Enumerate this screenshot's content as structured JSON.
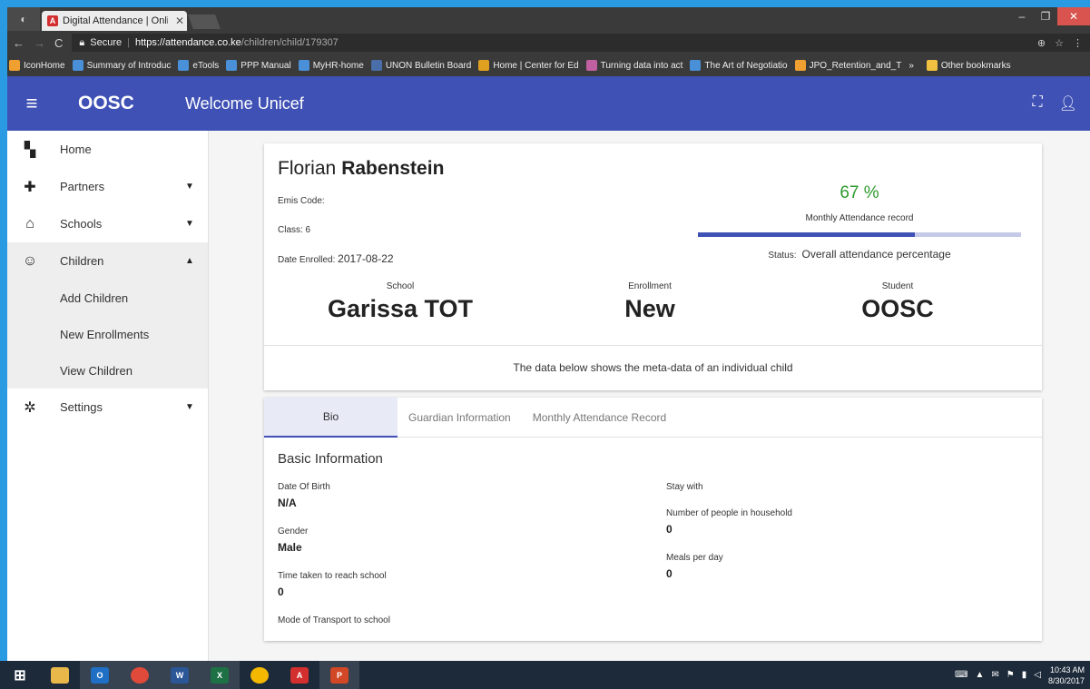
{
  "browser": {
    "tab_title": "Digital Attendance | Onli",
    "url_secure": "Secure",
    "url_host": "https://attendance.co.ke",
    "url_path": "/children/child/179307",
    "bookmarks": [
      {
        "label": "IconHome",
        "color": "#f0a030"
      },
      {
        "label": "Summary of Introduc",
        "color": "#4a90d9"
      },
      {
        "label": "eTools",
        "color": "#4a90d9"
      },
      {
        "label": "PPP Manual",
        "color": "#4a90d9"
      },
      {
        "label": "MyHR-home",
        "color": "#4a90d9"
      },
      {
        "label": "UNON Bulletin Board",
        "color": "#4a6ea9"
      },
      {
        "label": "Home | Center for Ed",
        "color": "#e0a020"
      },
      {
        "label": "Turning data into act",
        "color": "#c060a0"
      },
      {
        "label": "The Art of Negotiatio",
        "color": "#4a90d9"
      },
      {
        "label": "JPO_Retention_and_T",
        "color": "#f0a030"
      }
    ],
    "bookmarks_more": "»",
    "other_bookmarks": "Other bookmarks"
  },
  "app": {
    "brand": "OOSC",
    "welcome": "Welcome Unicef"
  },
  "sidebar": {
    "items": [
      {
        "label": "Home",
        "icon": "dashboard-icon",
        "glyph": "▚"
      },
      {
        "label": "Partners",
        "icon": "puzzle-icon",
        "glyph": "✚"
      },
      {
        "label": "Schools",
        "icon": "home-icon",
        "glyph": "⌂"
      },
      {
        "label": "Children",
        "icon": "face-icon",
        "glyph": "☺"
      },
      {
        "label": "Settings",
        "icon": "gear-icon",
        "glyph": "✲"
      }
    ],
    "children_sub": [
      "Add Children",
      "New Enrollments",
      "View Children"
    ]
  },
  "student": {
    "first_name": "Florian",
    "last_name": "Rabenstein",
    "emis_label": "Emis Code:",
    "class_label": "Class: 6",
    "enrolled_label": "Date Enrolled:",
    "enrolled_value": "2017-08-22",
    "attendance_pct_text": "67 %",
    "attendance_fraction": 0.67,
    "attendance_label": "Monthly Attendance record",
    "status_label": "Status:",
    "status_value": "Overall attendance percentage",
    "school_caption": "School",
    "school_value": "Garissa TOT",
    "enrollment_caption": "Enrollment",
    "enrollment_value": "New",
    "student_caption": "Student",
    "student_value": "OOSC",
    "note": "The data below shows the meta-data of an individual child"
  },
  "tabs": [
    "Bio",
    "Guardian Information",
    "Monthly Attendance Record"
  ],
  "bio": {
    "section_title": "Basic Information",
    "dob_label": "Date Of Birth",
    "dob_value": "N/A",
    "gender_label": "Gender",
    "gender_value": "Male",
    "time_label": "Time taken to reach school",
    "time_value": "0",
    "transport_label": "Mode of Transport to school",
    "stay_label": "Stay with",
    "household_label": "Number of people in household",
    "household_value": "0",
    "meals_label": "Meals per day",
    "meals_value": "0"
  },
  "taskbar": {
    "time": "10:43 AM",
    "date": "8/30/2017"
  },
  "colors": {
    "primary": "#3f51b5",
    "success": "#2e9a2e"
  }
}
